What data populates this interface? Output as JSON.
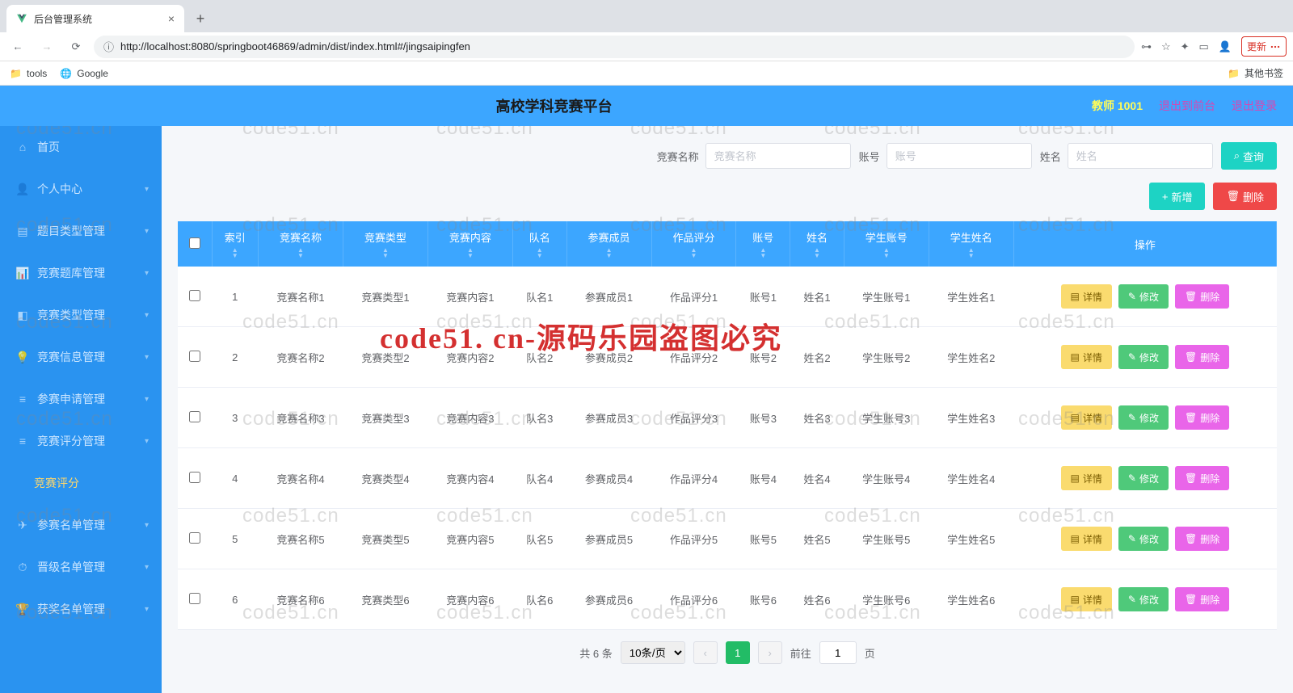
{
  "browser": {
    "tab_title": "后台管理系统",
    "url": "http://localhost:8080/springboot46869/admin/dist/index.html#/jingsaipingfen",
    "update_label": "更新",
    "bookmarks": {
      "tools": "tools",
      "google": "Google",
      "other": "其他书签"
    }
  },
  "header": {
    "title": "高校学科竞赛平台",
    "teacher": "教师 1001",
    "exit_front": "退出到前台",
    "logout": "退出登录"
  },
  "sidebar": {
    "items": [
      {
        "label": "首页",
        "icon": "home"
      },
      {
        "label": "个人中心",
        "icon": "user",
        "chev": true
      },
      {
        "label": "题目类型管理",
        "icon": "book",
        "chev": true
      },
      {
        "label": "竞赛题库管理",
        "icon": "chart",
        "chev": true
      },
      {
        "label": "竞赛类型管理",
        "icon": "tag",
        "chev": true
      },
      {
        "label": "竞赛信息管理",
        "icon": "bulb",
        "chev": true
      },
      {
        "label": "参赛申请管理",
        "icon": "list",
        "chev": true
      },
      {
        "label": "竞赛评分管理",
        "icon": "fire",
        "chev": true,
        "sub": "竞赛评分"
      },
      {
        "label": "参赛名单管理",
        "icon": "plane",
        "chev": true
      },
      {
        "label": "晋级名单管理",
        "icon": "clock",
        "chev": true
      },
      {
        "label": "获奖名单管理",
        "icon": "trophy",
        "chev": true
      }
    ]
  },
  "search": {
    "f1_label": "竞赛名称",
    "f1_ph": "竞赛名称",
    "f2_label": "账号",
    "f2_ph": "账号",
    "f3_label": "姓名",
    "f3_ph": "姓名",
    "query_label": "查询"
  },
  "actions": {
    "add": "新增",
    "delete": "删除"
  },
  "table": {
    "cols": [
      "索引",
      "竞赛名称",
      "竞赛类型",
      "竞赛内容",
      "队名",
      "参赛成员",
      "作品评分",
      "账号",
      "姓名",
      "学生账号",
      "学生姓名",
      "操作"
    ],
    "rows": [
      {
        "idx": "1",
        "c": [
          "竞赛名称1",
          "竞赛类型1",
          "竞赛内容1",
          "队名1",
          "参赛成员1",
          "作品评分1",
          "账号1",
          "姓名1",
          "学生账号1",
          "学生姓名1"
        ]
      },
      {
        "idx": "2",
        "c": [
          "竞赛名称2",
          "竞赛类型2",
          "竞赛内容2",
          "队名2",
          "参赛成员2",
          "作品评分2",
          "账号2",
          "姓名2",
          "学生账号2",
          "学生姓名2"
        ]
      },
      {
        "idx": "3",
        "c": [
          "竞赛名称3",
          "竞赛类型3",
          "竞赛内容3",
          "队名3",
          "参赛成员3",
          "作品评分3",
          "账号3",
          "姓名3",
          "学生账号3",
          "学生姓名3"
        ]
      },
      {
        "idx": "4",
        "c": [
          "竞赛名称4",
          "竞赛类型4",
          "竞赛内容4",
          "队名4",
          "参赛成员4",
          "作品评分4",
          "账号4",
          "姓名4",
          "学生账号4",
          "学生姓名4"
        ]
      },
      {
        "idx": "5",
        "c": [
          "竞赛名称5",
          "竞赛类型5",
          "竞赛内容5",
          "队名5",
          "参赛成员5",
          "作品评分5",
          "账号5",
          "姓名5",
          "学生账号5",
          "学生姓名5"
        ]
      },
      {
        "idx": "6",
        "c": [
          "竞赛名称6",
          "竞赛类型6",
          "竞赛内容6",
          "队名6",
          "参赛成员6",
          "作品评分6",
          "账号6",
          "姓名6",
          "学生账号6",
          "学生姓名6"
        ]
      }
    ],
    "ops": {
      "detail": "详情",
      "edit": "修改",
      "delete": "删除"
    }
  },
  "pager": {
    "total": "共 6 条",
    "per_page": "10条/页",
    "current": "1",
    "goto_pre": "前往",
    "goto_val": "1",
    "goto_suf": "页"
  },
  "watermark_text": "code51.cn",
  "watermark_big": "code51. cn-源码乐园盗图必究"
}
